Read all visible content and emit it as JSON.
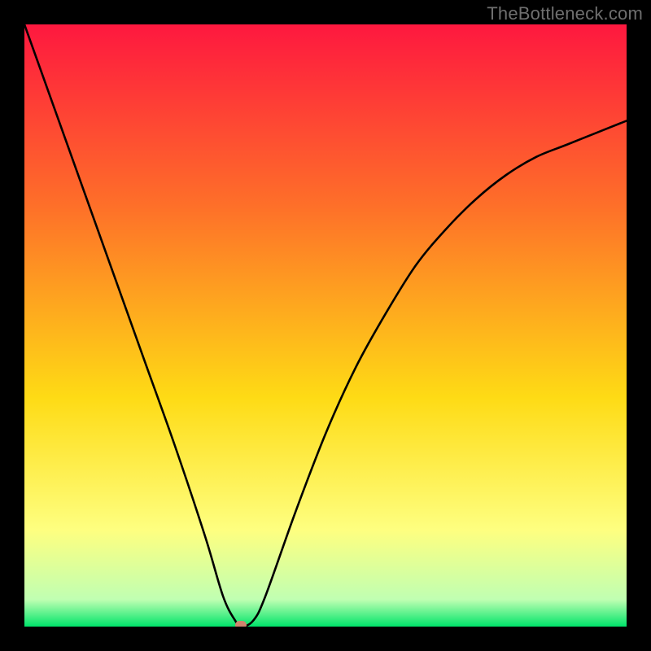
{
  "watermark": "TheBottleneck.com",
  "colors": {
    "top": "#fe183f",
    "upper_mid": "#fe6f29",
    "mid": "#fedb15",
    "lower_mid": "#feff80",
    "near_bottom": "#c0ffb2",
    "bottom": "#00e46a",
    "frame": "#000000",
    "curve": "#000000",
    "marker": "#cf846e"
  },
  "chart_data": {
    "type": "line",
    "title": "",
    "xlabel": "",
    "ylabel": "",
    "xlim": [
      0,
      100
    ],
    "ylim": [
      0,
      100
    ],
    "annotations": [
      "TheBottleneck.com"
    ],
    "series": [
      {
        "name": "bottleneck-curve",
        "x": [
          0,
          5,
          10,
          15,
          20,
          25,
          30,
          33,
          35,
          36,
          38,
          40,
          45,
          50,
          55,
          60,
          65,
          70,
          75,
          80,
          85,
          90,
          95,
          100
        ],
        "y": [
          100,
          86,
          72,
          58,
          44,
          30,
          15,
          5,
          1,
          0,
          1,
          5,
          19,
          32,
          43,
          52,
          60,
          66,
          71,
          75,
          78,
          80,
          82,
          84
        ]
      }
    ],
    "marker": {
      "x": 36,
      "y": 0
    },
    "description": "V-shaped bottleneck curve on a vertical red-to-green gradient. Minimum (optimal point) near x≈36 at y=0. Left branch is steep and nearly linear from (0,100) to the minimum; right branch rises with decreasing slope toward (100,≈84)."
  }
}
